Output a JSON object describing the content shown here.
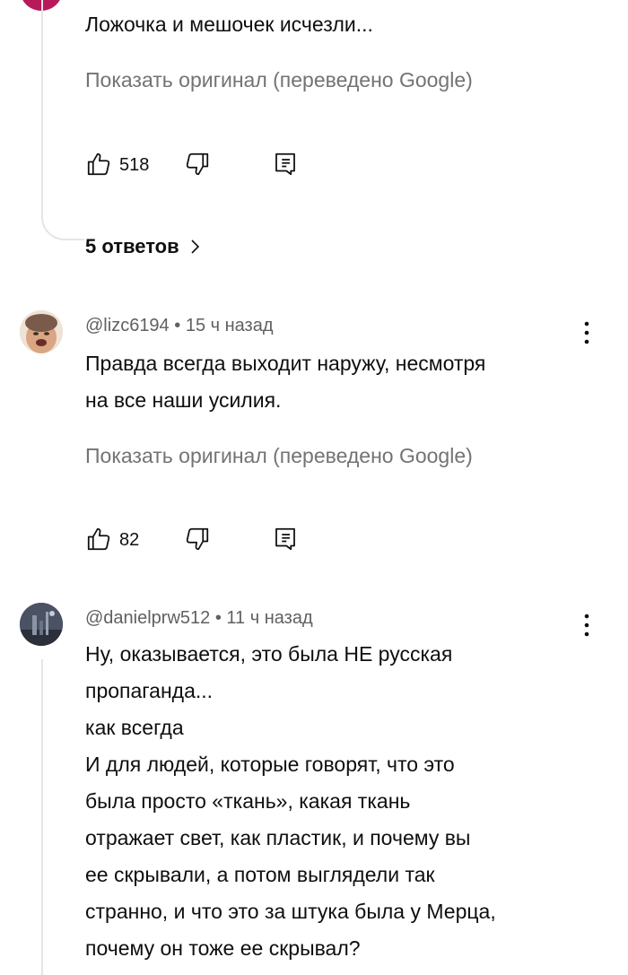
{
  "comments": [
    {
      "text": "Ложочка и мешочек исчезли...",
      "translate_label": "Показать оригинал (переведено Google)",
      "likes": "518",
      "replies_label": "5 ответов"
    },
    {
      "author": "@lizc6194",
      "time": "15 ч назад",
      "text_lines": [
        "Правда всегда выходит наружу, несмотря",
        "на все наши усилия."
      ],
      "translate_label": "Показать оригинал (переведено Google)",
      "likes": "82"
    },
    {
      "author": "@danielprw512",
      "time": "11 ч назад",
      "text_lines": [
        "Ну, оказывается, это была НЕ русская",
        "пропаганда...",
        "как всегда",
        "И для людей, которые говорят, что это",
        "была просто «ткань», какая ткань",
        "отражает свет, как пластик, и почему вы",
        "ее скрывали, а потом выглядели так",
        "странно, и что это за штука была у Мерца,",
        "почему он тоже ее скрывал?"
      ]
    }
  ],
  "separator": "•",
  "icons": [
    "like-icon",
    "dislike-icon",
    "reply-icon",
    "more-vert-icon",
    "chevron-right-icon"
  ],
  "colors": {
    "accent_avatar": "#b8195a",
    "secondary_text": "#606060",
    "translate_text": "#737373"
  }
}
